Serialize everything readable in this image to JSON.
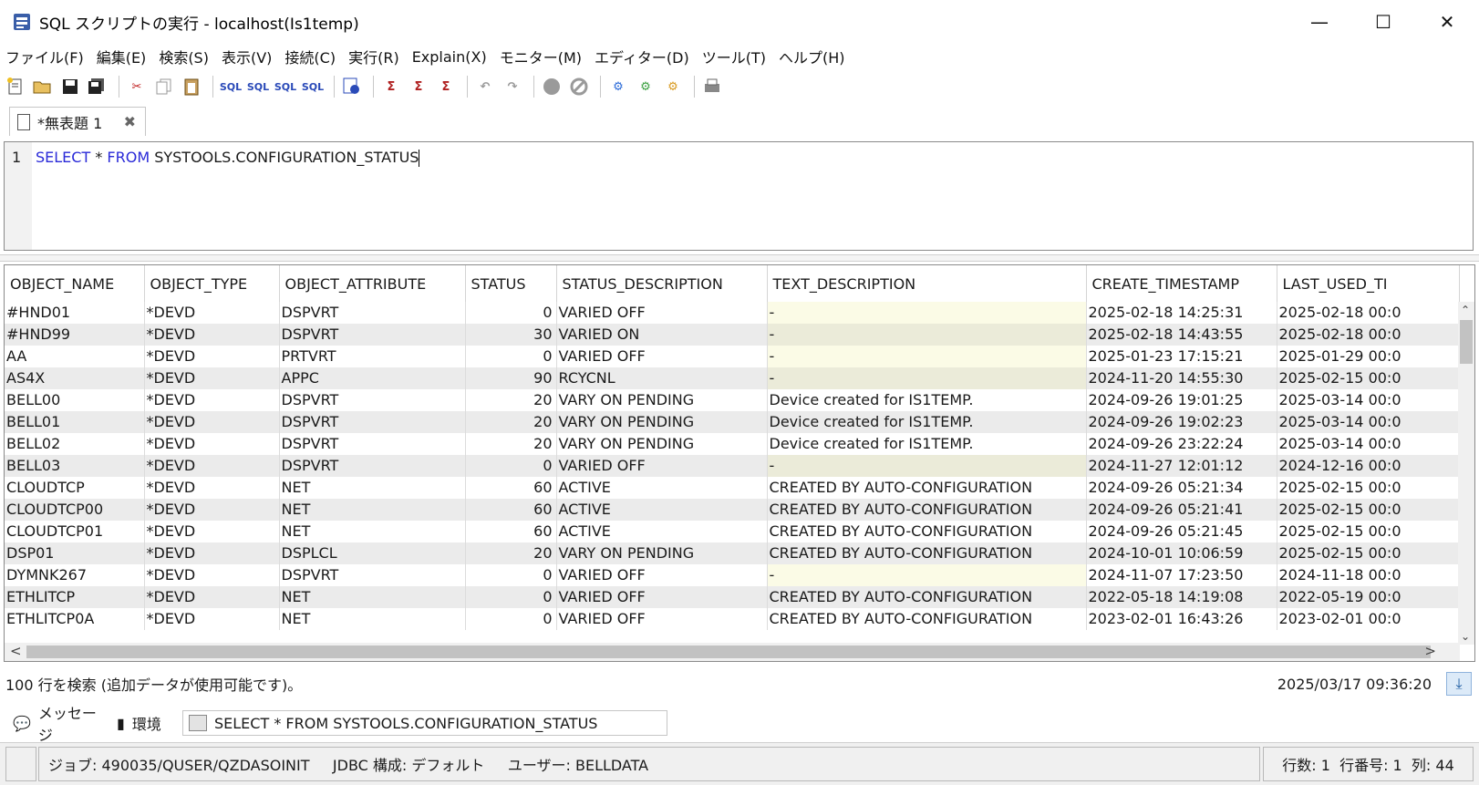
{
  "window": {
    "title": "SQL スクリプトの実行 - localhost(Is1temp)"
  },
  "menu": [
    "ファイル(F)",
    "編集(E)",
    "検索(S)",
    "表示(V)",
    "接続(C)",
    "実行(R)",
    "Explain(X)",
    "モニター(M)",
    "エディター(D)",
    "ツール(T)",
    "ヘルプ(H)"
  ],
  "editor_tab": {
    "label": "*無表題 1"
  },
  "editor": {
    "line_number": "1",
    "kw1": "SELECT",
    "mid": " * ",
    "kw2": "FROM",
    "rest": " SYSTOOLS.CONFIGURATION_STATUS"
  },
  "grid": {
    "columns": [
      "OBJECT_NAME",
      "OBJECT_TYPE",
      "OBJECT_ATTRIBUTE",
      "STATUS",
      "STATUS_DESCRIPTION",
      "TEXT_DESCRIPTION",
      "CREATE_TIMESTAMP",
      "LAST_USED_TI"
    ],
    "rows": [
      [
        "#HND01",
        "*DEVD",
        "DSPVRT",
        "0",
        "VARIED OFF",
        "-",
        "2025-02-18 14:25:31",
        "2025-02-18 00:0"
      ],
      [
        "#HND99",
        "*DEVD",
        "DSPVRT",
        "30",
        "VARIED ON",
        "-",
        "2025-02-18 14:43:55",
        "2025-02-18 00:0"
      ],
      [
        "AA",
        "*DEVD",
        "PRTVRT",
        "0",
        "VARIED OFF",
        "-",
        "2025-01-23 17:15:21",
        "2025-01-29 00:0"
      ],
      [
        "AS4X",
        "*DEVD",
        "APPC",
        "90",
        "RCYCNL",
        "-",
        "2024-11-20 14:55:30",
        "2025-02-15 00:0"
      ],
      [
        "BELL00",
        "*DEVD",
        "DSPVRT",
        "20",
        "VARY ON PENDING",
        "Device created for IS1TEMP.",
        "2024-09-26 19:01:25",
        "2025-03-14 00:0"
      ],
      [
        "BELL01",
        "*DEVD",
        "DSPVRT",
        "20",
        "VARY ON PENDING",
        "Device created for IS1TEMP.",
        "2024-09-26 19:02:23",
        "2025-03-14 00:0"
      ],
      [
        "BELL02",
        "*DEVD",
        "DSPVRT",
        "20",
        "VARY ON PENDING",
        "Device created for IS1TEMP.",
        "2024-09-26 23:22:24",
        "2025-03-14 00:0"
      ],
      [
        "BELL03",
        "*DEVD",
        "DSPVRT",
        "0",
        "VARIED OFF",
        "-",
        "2024-11-27 12:01:12",
        "2024-12-16 00:0"
      ],
      [
        "CLOUDTCP",
        "*DEVD",
        "NET",
        "60",
        "ACTIVE",
        "CREATED BY AUTO-CONFIGURATION",
        "2024-09-26 05:21:34",
        "2025-02-15 00:0"
      ],
      [
        "CLOUDTCP00",
        "*DEVD",
        "NET",
        "60",
        "ACTIVE",
        "CREATED BY AUTO-CONFIGURATION",
        "2024-09-26 05:21:41",
        "2025-02-15 00:0"
      ],
      [
        "CLOUDTCP01",
        "*DEVD",
        "NET",
        "60",
        "ACTIVE",
        "CREATED BY AUTO-CONFIGURATION",
        "2024-09-26 05:21:45",
        "2025-02-15 00:0"
      ],
      [
        "DSP01",
        "*DEVD",
        "DSPLCL",
        "20",
        "VARY ON PENDING",
        "CREATED BY AUTO-CONFIGURATION",
        "2024-10-01 10:06:59",
        "2025-02-15 00:0"
      ],
      [
        "DYMNK267",
        "*DEVD",
        "DSPVRT",
        "0",
        "VARIED OFF",
        "-",
        "2024-11-07 17:23:50",
        "2024-11-18 00:0"
      ],
      [
        "ETHLITCP",
        "*DEVD",
        "NET",
        "0",
        "VARIED OFF",
        "CREATED BY AUTO-CONFIGURATION",
        "2022-05-18 14:19:08",
        "2022-05-19 00:0"
      ],
      [
        "ETHLITCP0A",
        "*DEVD",
        "NET",
        "0",
        "VARIED OFF",
        "CREATED BY AUTO-CONFIGURATION",
        "2023-02-01 16:43:26",
        "2023-02-01 00:0"
      ]
    ]
  },
  "result": {
    "count": "100 行を検索 (追加データが使用可能です)。",
    "timestamp": "2025/03/17 09:36:20"
  },
  "bottom_tabs": {
    "messages": "メッセージ",
    "environment": "環境",
    "result": "SELECT * FROM SYSTOOLS.CONFIGURATION_STATUS"
  },
  "status": {
    "job": "ジョブ: 490035/QUSER/QZDASOINIT     JDBC 構成: デフォルト     ユーザー: BELLDATA",
    "position": "行数: 1  行番号: 1  列: 44"
  }
}
